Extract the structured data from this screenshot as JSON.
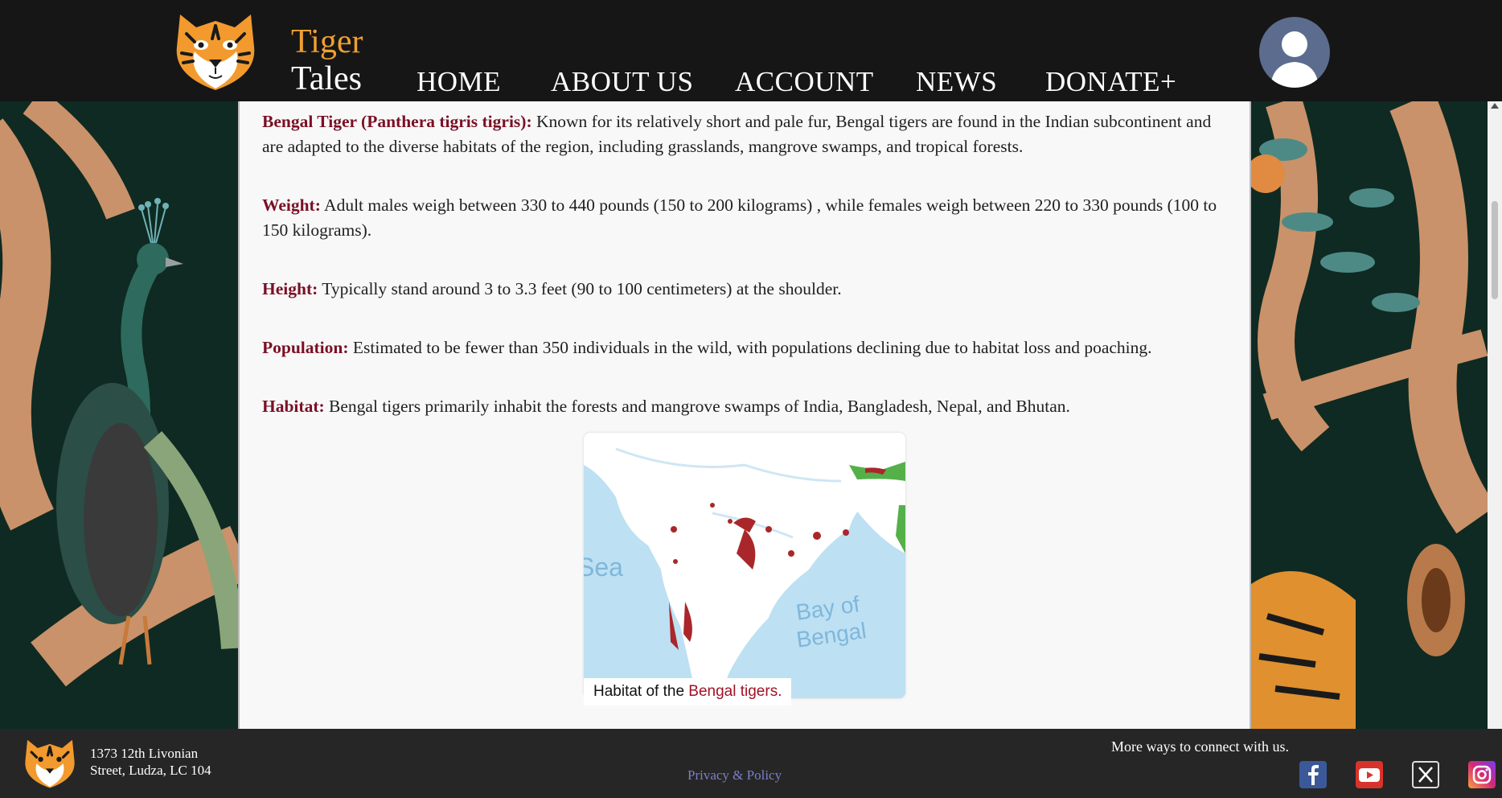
{
  "brand": {
    "line1": "Tiger",
    "line2": "Tales"
  },
  "nav": {
    "items": [
      {
        "label": "HOME"
      },
      {
        "label": "ABOUT US"
      },
      {
        "label": "ACCOUNT"
      },
      {
        "label": "NEWS"
      },
      {
        "label": "DONATE+"
      }
    ]
  },
  "content": {
    "paragraphs": [
      {
        "label": "Bengal Tiger (Panthera tigris tigris):",
        "text": " Known for its relatively short and pale fur, Bengal tigers are found in the Indian subcontinent and are adapted to the diverse habitats of the region, including grasslands, mangrove swamps, and tropical forests."
      },
      {
        "label": "Weight:",
        "text": " Adult males weigh between 330 to 440 pounds (150 to 200 kilograms) , while females weigh between 220 to 330 pounds (100 to 150 kilograms)."
      },
      {
        "label": "Height:",
        "text": " Typically stand around 3 to 3.3 feet (90 to 100 centimeters) at the shoulder."
      },
      {
        "label": "Population:",
        "text": " Estimated to be fewer than 350 individuals in the wild, with populations declining due to habitat loss and poaching."
      },
      {
        "label": "Habitat:",
        "text": " Bengal tigers primarily inhabit the forests and mangrove swamps of India, Bangladesh, Nepal, and Bhutan."
      }
    ],
    "map": {
      "label_sea": "Sea",
      "label_bay_1": "Bay of",
      "label_bay_2": "Bengal"
    },
    "caption": {
      "prefix": "Habitat of the ",
      "link": "Bengal tigers."
    }
  },
  "footer": {
    "address_line1": "1373 12th Livonian",
    "address_line2": "Street, Ludza, LC 104",
    "privacy": "Privacy & Policy",
    "connect": "More ways to connect with us.",
    "social": [
      {
        "icon": "facebook-icon"
      },
      {
        "icon": "youtube-icon"
      },
      {
        "icon": "x-icon"
      },
      {
        "icon": "instagram-icon"
      }
    ]
  },
  "colors": {
    "accent": "#f0a030",
    "label": "#7a1024",
    "header_bg": "#161616",
    "footer_bg": "#262626",
    "link": "#a01228"
  }
}
